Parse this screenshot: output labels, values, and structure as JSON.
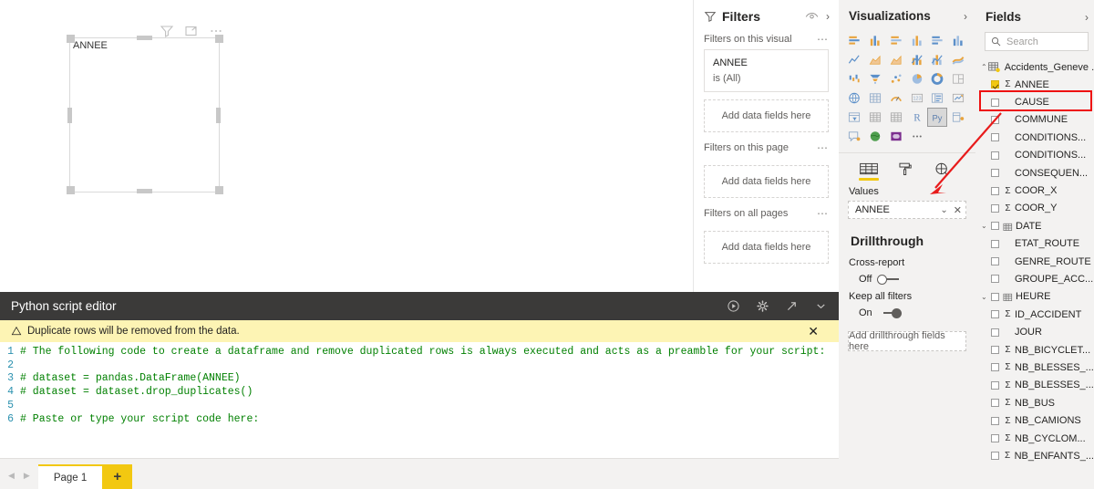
{
  "canvas": {
    "visual_title": "ANNEE",
    "header_icons": [
      "filter-icon",
      "focus-mode-icon",
      "more-options-icon"
    ]
  },
  "python_editor": {
    "title": "Python script editor",
    "actions": [
      "run-script-icon",
      "settings-icon",
      "open-external-editor-icon",
      "collapse-icon"
    ],
    "warning": "Duplicate rows will be removed from the data.",
    "warning_close": "✕",
    "lines": [
      {
        "no": "1",
        "text": "# The following code to create a dataframe and remove duplicated rows is always executed and acts as a preamble for your script:"
      },
      {
        "no": "2",
        "text": ""
      },
      {
        "no": "3",
        "text": "# dataset = pandas.DataFrame(ANNEE)"
      },
      {
        "no": "4",
        "text": "# dataset = dataset.drop_duplicates()"
      },
      {
        "no": "5",
        "text": ""
      },
      {
        "no": "6",
        "text": "# Paste or type your script code here:"
      }
    ]
  },
  "page_tabs": {
    "prev_label": "◀",
    "next_label": "▶",
    "pages": [
      "Page 1"
    ],
    "add_label": "+"
  },
  "filters": {
    "title": "Filters",
    "hide_icon": "eye-icon",
    "expand_icon": "›",
    "sections": [
      {
        "label": "Filters on this visual",
        "menu": "⋯",
        "cards": [
          {
            "name": "ANNEE",
            "value": "is (All)"
          }
        ],
        "dropzone": "Add data fields here"
      },
      {
        "label": "Filters on this page",
        "menu": "⋯",
        "cards": [],
        "dropzone": "Add data fields here"
      },
      {
        "label": "Filters on all pages",
        "menu": "⋯",
        "cards": [],
        "dropzone": "Add data fields here"
      }
    ]
  },
  "visualizations": {
    "title": "Visualizations",
    "expand_icon": "›",
    "icons": [
      "stacked-bar-chart-icon",
      "stacked-column-chart-icon",
      "clustered-bar-chart-icon",
      "clustered-column-chart-icon",
      "100-stacked-bar-chart-icon",
      "100-stacked-column-chart-icon",
      "line-chart-icon",
      "area-chart-icon",
      "stacked-area-chart-icon",
      "line-stacked-column-chart-icon",
      "line-clustered-column-chart-icon",
      "ribbon-chart-icon",
      "waterfall-chart-icon",
      "funnel-chart-icon",
      "scatter-chart-icon",
      "pie-chart-icon",
      "donut-chart-icon",
      "treemap-icon",
      "map-icon",
      "filled-map-icon",
      "gauge-icon",
      "card-icon",
      "multi-row-card-icon",
      "kpi-icon",
      "slicer-icon",
      "table-icon",
      "matrix-icon",
      "r-script-visual-icon",
      "python-visual-icon",
      "key-influencers-icon",
      "qa-visual-icon",
      "arcgis-map-icon",
      "paginated-report-icon",
      "more-visuals-icon"
    ],
    "selected_icon": "python-visual-icon",
    "tabs": [
      {
        "name": "fields-tab",
        "icon": "fields-table-icon",
        "active": true
      },
      {
        "name": "format-tab",
        "icon": "paint-roller-icon",
        "active": false
      },
      {
        "name": "analytics-tab",
        "icon": "magnifier-icon",
        "active": false
      }
    ],
    "wells": [
      {
        "label": "Values",
        "value": "ANNEE",
        "chevron": "⌄",
        "remove": "✕"
      }
    ],
    "drillthrough": {
      "title": "Drillthrough",
      "cross_report": {
        "label": "Cross-report",
        "state": "Off",
        "on": false
      },
      "keep_all_filters": {
        "label": "Keep all filters",
        "state": "On",
        "on": true
      },
      "dropzone": "Add drillthrough fields here"
    }
  },
  "fields": {
    "title": "Fields",
    "expand_icon": "›",
    "search_placeholder": "Search",
    "search_icon": "search-icon",
    "table": {
      "name": "Accidents_Geneve ...",
      "chevron": "⌃",
      "icon": "table-icon"
    },
    "items": [
      {
        "label": "ANNEE",
        "checked": true,
        "sigma": true,
        "chevron": "",
        "icon": "",
        "highlight": true
      },
      {
        "label": "CAUSE",
        "checked": false,
        "sigma": false,
        "chevron": "",
        "icon": ""
      },
      {
        "label": "COMMUNE",
        "checked": false,
        "sigma": false,
        "chevron": "",
        "icon": ""
      },
      {
        "label": "CONDITIONS...",
        "checked": false,
        "sigma": false,
        "chevron": "",
        "icon": ""
      },
      {
        "label": "CONDITIONS...",
        "checked": false,
        "sigma": false,
        "chevron": "",
        "icon": ""
      },
      {
        "label": "CONSEQUEN...",
        "checked": false,
        "sigma": false,
        "chevron": "",
        "icon": ""
      },
      {
        "label": "COOR_X",
        "checked": false,
        "sigma": true,
        "chevron": "",
        "icon": ""
      },
      {
        "label": "COOR_Y",
        "checked": false,
        "sigma": true,
        "chevron": "",
        "icon": ""
      },
      {
        "label": "DATE",
        "checked": false,
        "sigma": false,
        "chevron": "⌄",
        "icon": "calendar-icon"
      },
      {
        "label": "ETAT_ROUTE",
        "checked": false,
        "sigma": false,
        "chevron": "",
        "icon": ""
      },
      {
        "label": "GENRE_ROUTE",
        "checked": false,
        "sigma": false,
        "chevron": "",
        "icon": ""
      },
      {
        "label": "GROUPE_ACC...",
        "checked": false,
        "sigma": false,
        "chevron": "",
        "icon": ""
      },
      {
        "label": "HEURE",
        "checked": false,
        "sigma": false,
        "chevron": "⌄",
        "icon": "calendar-icon"
      },
      {
        "label": "ID_ACCIDENT",
        "checked": false,
        "sigma": true,
        "chevron": "",
        "icon": ""
      },
      {
        "label": "JOUR",
        "checked": false,
        "sigma": false,
        "chevron": "",
        "icon": ""
      },
      {
        "label": "NB_BICYCLET...",
        "checked": false,
        "sigma": true,
        "chevron": "",
        "icon": ""
      },
      {
        "label": "NB_BLESSES_...",
        "checked": false,
        "sigma": true,
        "chevron": "",
        "icon": ""
      },
      {
        "label": "NB_BLESSES_...",
        "checked": false,
        "sigma": true,
        "chevron": "",
        "icon": ""
      },
      {
        "label": "NB_BUS",
        "checked": false,
        "sigma": true,
        "chevron": "",
        "icon": ""
      },
      {
        "label": "NB_CAMIONS",
        "checked": false,
        "sigma": true,
        "chevron": "",
        "icon": ""
      },
      {
        "label": "NB_CYCLOM...",
        "checked": false,
        "sigma": true,
        "chevron": "",
        "icon": ""
      },
      {
        "label": "NB_ENFANTS_...",
        "checked": false,
        "sigma": true,
        "chevron": "",
        "icon": ""
      }
    ]
  },
  "annotation": {
    "highlight_color": "#ee1111",
    "arrow_color": "#e81b1b",
    "description": "red-arrow-from-annee-field-to-values-well"
  },
  "colors": {
    "accent": "#f2c811",
    "editor_header": "#3b3a39",
    "warning_bg": "#fdf4b4",
    "pane_bg": "#f3f2f1",
    "code_comment": "#008000",
    "line_number": "#2b91af"
  }
}
